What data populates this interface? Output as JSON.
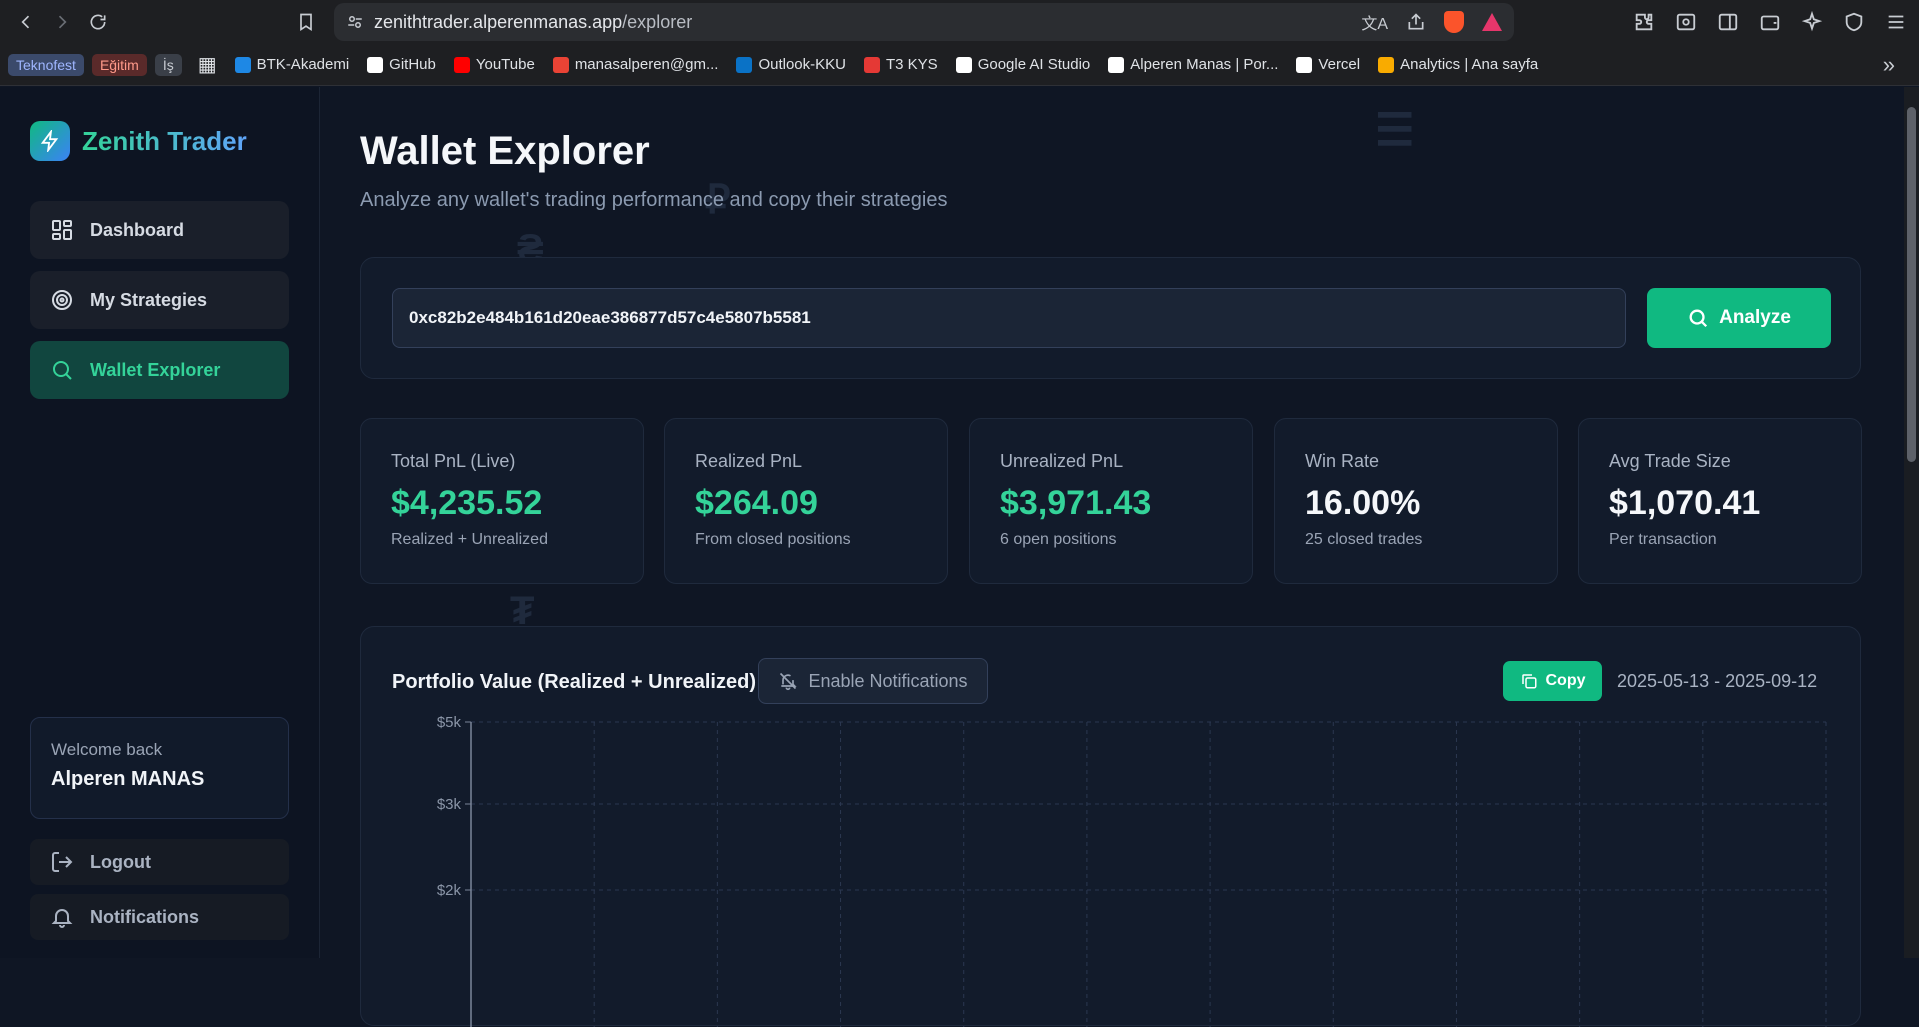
{
  "browser": {
    "url_host": "zenithtrader.alperenmanas.app",
    "url_path": "/explorer",
    "bookmarks": [
      {
        "label": "Teknofest",
        "type": "tag",
        "color": "#3b4a6b",
        "text_color": "#9fb6ff"
      },
      {
        "label": "Eğitim",
        "type": "tag",
        "color": "#5a2a2a",
        "text_color": "#ff9a8a"
      },
      {
        "label": "İş",
        "type": "tag",
        "color": "#3a3f48",
        "text_color": "#c8ccd2"
      },
      {
        "label": "BTK-Akademi",
        "type": "link",
        "color": "#1e88e5"
      },
      {
        "label": "GitHub",
        "type": "link",
        "color": "#ffffff"
      },
      {
        "label": "YouTube",
        "type": "link",
        "color": "#ff0000"
      },
      {
        "label": "manasalperen@gm...",
        "type": "link",
        "color": "#ea4335"
      },
      {
        "label": "Outlook-KKU",
        "type": "link",
        "color": "#0a72c6"
      },
      {
        "label": "T3 KYS",
        "type": "link",
        "color": "#e53935"
      },
      {
        "label": "Google AI Studio",
        "type": "link",
        "color": "#ffffff"
      },
      {
        "label": "Alperen Manas | Por...",
        "type": "link",
        "color": "#ffffff"
      },
      {
        "label": "Vercel",
        "type": "link",
        "color": "#ffffff"
      },
      {
        "label": "Analytics | Ana sayfa",
        "type": "link",
        "color": "#f9ab00"
      }
    ]
  },
  "sidebar": {
    "brand": "Zenith Trader",
    "items": [
      {
        "label": "Dashboard",
        "icon": "dashboard-grid-icon",
        "active": false
      },
      {
        "label": "My Strategies",
        "icon": "target-icon",
        "active": false
      },
      {
        "label": "Wallet Explorer",
        "icon": "search-icon",
        "active": true
      }
    ],
    "welcome_label": "Welcome back",
    "user_name": "Alperen MANAS",
    "logout_label": "Logout",
    "notifications_label": "Notifications"
  },
  "main": {
    "title": "Wallet Explorer",
    "subtitle": "Analyze any wallet's trading performance and copy their strategies",
    "search_value": "0xc82b2e484b161d20eae386877d57c4e5807b5581",
    "analyze_label": "Analyze",
    "stats": [
      {
        "label": "Total PnL (Live)",
        "value": "$4,235.52",
        "sub": "Realized + Unrealized",
        "accent": "green"
      },
      {
        "label": "Realized PnL",
        "value": "$264.09",
        "sub": "From closed positions",
        "accent": "green"
      },
      {
        "label": "Unrealized PnL",
        "value": "$3,971.43",
        "sub": "6 open positions",
        "accent": "green"
      },
      {
        "label": "Win Rate",
        "value": "16.00%",
        "sub": "25 closed trades",
        "accent": "white"
      },
      {
        "label": "Avg Trade Size",
        "value": "$1,070.41",
        "sub": "Per transaction",
        "accent": "white"
      }
    ],
    "chart_card": {
      "title": "Portfolio Value (Realized + Unrealized)",
      "notif_label": "Enable Notifications",
      "copy_label": "Copy",
      "date_range": "2025-05-13 - 2025-09-12"
    }
  },
  "colors": {
    "accent": "#10b981",
    "accent_text": "#34d399",
    "background": "#0f1624"
  },
  "chart_data": {
    "type": "line",
    "title": "Portfolio Value (Realized + Unrealized)",
    "y_ticks": [
      "$5k",
      "$3k",
      "$2k"
    ],
    "y_tick_values": [
      5000,
      3000,
      2000
    ],
    "grid": true,
    "series": []
  }
}
